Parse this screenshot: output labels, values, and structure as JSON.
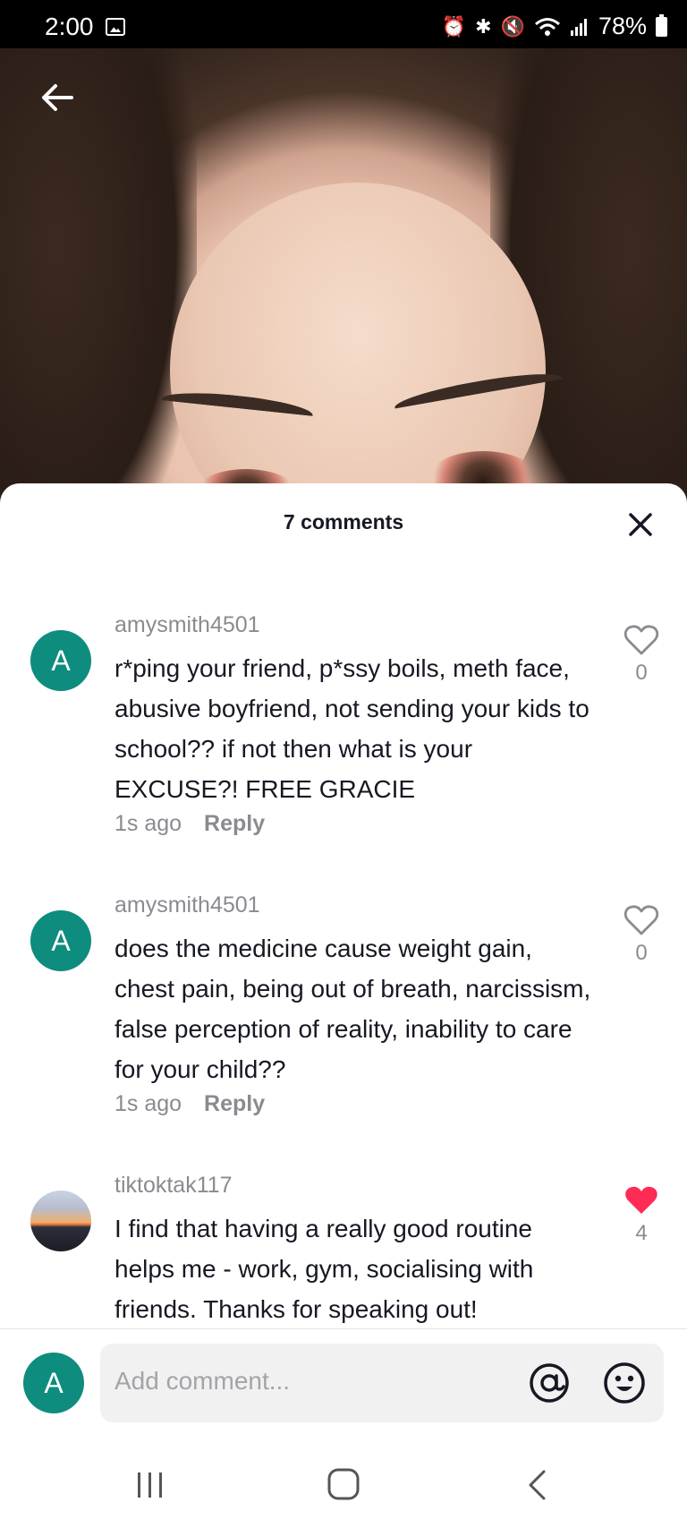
{
  "status_bar": {
    "time": "2:00",
    "battery": "78%"
  },
  "sheet": {
    "comment_count": "7 comments"
  },
  "comments": [
    {
      "avatar_letter": "A",
      "username": "amysmith4501",
      "text": "r*ping your friend, p*ssy boils, meth face, abusive boyfriend, not sending your kids to school?? if not then what is your EXCUSE?! FREE GRACIE",
      "time": "1s ago",
      "reply_label": "Reply",
      "likes": "0",
      "liked": false
    },
    {
      "avatar_letter": "A",
      "username": "amysmith4501",
      "text": "does the medicine cause weight gain, chest pain, being out of breath, narcissism, false perception of reality, inability to care for your child??",
      "time": "1s ago",
      "reply_label": "Reply",
      "likes": "0",
      "liked": false
    },
    {
      "avatar_letter": "",
      "username": "tiktoktak117",
      "text": "I find that having a really good routine helps me - work, gym, socialising with friends. Thanks for speaking out!",
      "likes": "4",
      "liked": true
    }
  ],
  "composer": {
    "avatar_letter": "A",
    "placeholder": "Add comment..."
  },
  "colors": {
    "avatar_teal": "#0e8c7e",
    "liked_red": "#fe2c55",
    "secondary_text": "#8a8b91",
    "primary_text": "#161823"
  },
  "icons": {
    "back": "arrow-left-icon",
    "close": "close-icon",
    "like": "heart-icon",
    "mention": "at-sign-icon",
    "emoji": "smiley-icon",
    "nav_recents": "recent-apps-icon",
    "nav_home": "home-icon",
    "nav_back": "chevron-left-icon"
  }
}
